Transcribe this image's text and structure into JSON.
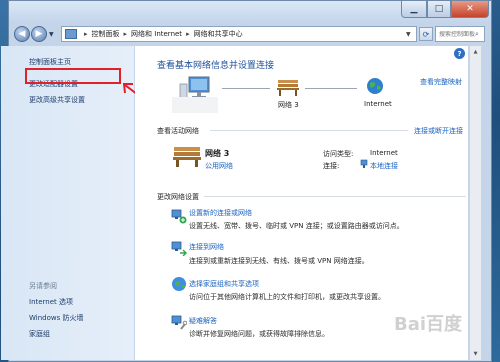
{
  "window": {
    "breadcrumbs": [
      "控制面板",
      "网络和 Internet",
      "网络和共享中心"
    ],
    "search_placeholder": "搜索控制面板"
  },
  "sidebar": {
    "home": "控制面板主页",
    "adapter": "更改适配器设置",
    "sharing": "更改高级共享设置",
    "see_also_heading": "另请参阅",
    "see_also": [
      "Internet 选项",
      "Windows 防火墙",
      "家庭组"
    ]
  },
  "main": {
    "title": "查看基本网络信息并设置连接",
    "view_full_map": "查看完整映射",
    "map": {
      "network_label": "网络  3",
      "internet_label": "Internet"
    },
    "active_heading": "查看活动网络",
    "connect_disconnect": "连接或断开连接",
    "active_network": {
      "name": "网络  3",
      "type": "公用网络",
      "access_type_label": "访问类型:",
      "access_type_value": "Internet",
      "connections_label": "连接:",
      "connections_value": "本地连接"
    },
    "change_heading": "更改网络设置",
    "tasks": [
      {
        "icon": "network-setup-icon",
        "link": "设置新的连接或网络",
        "desc": "设置无线、宽带、拨号、临时或 VPN 连接；或设置路由器或访问点。"
      },
      {
        "icon": "connect-network-icon",
        "link": "连接到网络",
        "desc": "连接到或重新连接到无线、有线、拨号或 VPN 网络连接。"
      },
      {
        "icon": "homegroup-icon",
        "link": "选择家庭组和共享选项",
        "desc": "访问位于其他网络计算机上的文件和打印机，或更改共享设置。"
      },
      {
        "icon": "troubleshoot-icon",
        "link": "疑难解答",
        "desc": "诊断并修复网络问题，或获得故障排除信息。"
      }
    ]
  },
  "colors": {
    "link": "#1a62c0",
    "title": "#1d4f9a",
    "highlight": "#e0212a"
  },
  "watermark": "Bai百度"
}
